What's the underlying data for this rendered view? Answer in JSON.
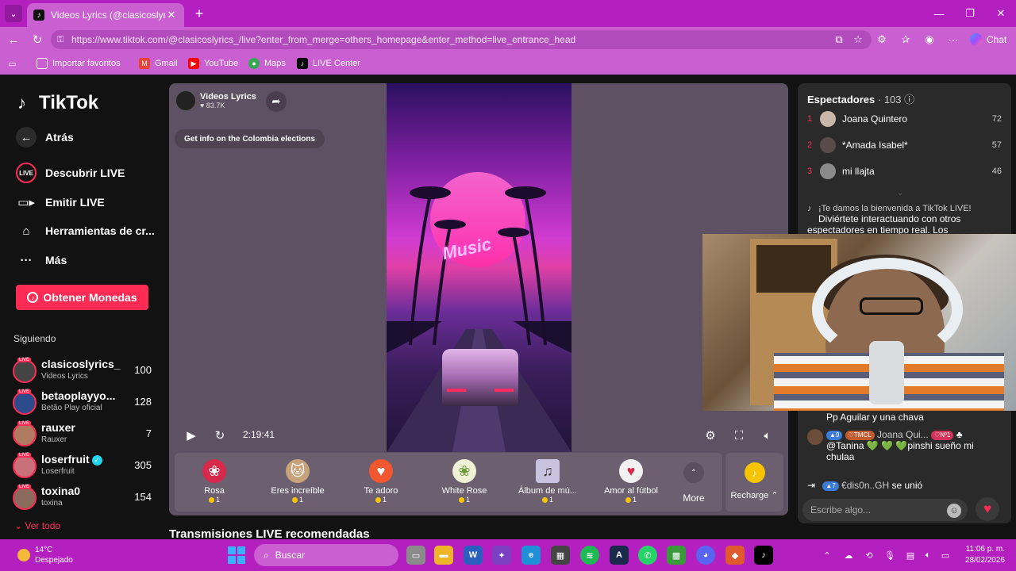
{
  "browser": {
    "tab_title": "Videos Lyrics (@clasicoslyrics_) est",
    "url": "https://www.tiktok.com/@clasicoslyrics_/live?enter_from_merge=others_homepage&enter_method=live_entrance_head",
    "chat_label": "Chat",
    "bookmarks": [
      "Importar favoritos",
      "Gmail",
      "YouTube",
      "Maps",
      "LIVE Center"
    ]
  },
  "sidebar": {
    "logo": "TikTok",
    "back": "Atrás",
    "nav": [
      "Descubrir LIVE",
      "Emitir LIVE",
      "Herramientas de cr...",
      "Más"
    ],
    "coins_button": "Obtener Monedas",
    "following_heading": "Siguiendo",
    "following": [
      {
        "name": "clasicoslyrics_",
        "sub": "Videos Lyrics",
        "count": "100"
      },
      {
        "name": "betaoplayyo...",
        "sub": "Betão Play oficial",
        "count": "128"
      },
      {
        "name": "rauxer",
        "sub": "Rauxer",
        "count": "7"
      },
      {
        "name": "loserfruit",
        "sub": "Loserfruit",
        "count": "305"
      },
      {
        "name": "toxina0",
        "sub": "toxina",
        "count": "154"
      }
    ],
    "see_all": "Ver todo"
  },
  "player": {
    "host_name": "Videos Lyrics",
    "host_likes": "83.7K",
    "info_pill": "Get info on the Colombia elections",
    "elapsed": "2:19:41",
    "gifts": [
      {
        "name": "Rosa",
        "cost": "1",
        "icon": "rose-icon"
      },
      {
        "name": "Eres increíble",
        "cost": "1",
        "icon": "cat-icon"
      },
      {
        "name": "Te adoro",
        "cost": "1",
        "icon": "heart-face-icon"
      },
      {
        "name": "White Rose",
        "cost": "1",
        "icon": "white-rose-icon"
      },
      {
        "name": "Álbum de mú...",
        "cost": "1",
        "icon": "album-icon"
      },
      {
        "name": "Amor al fútbol",
        "cost": "1",
        "icon": "football-heart-icon"
      }
    ],
    "more_label": "More",
    "recharge_label": "Recharge"
  },
  "recommended_heading": "Transmisiones LIVE recomendadas",
  "chat": {
    "viewers_label": "Espectadores",
    "viewers_count": "· 103",
    "top_viewers": [
      {
        "rank": "1",
        "name": "Joana Quintero",
        "score": "72"
      },
      {
        "rank": "2",
        "name": "*Amada Isabel*",
        "score": "57"
      },
      {
        "rank": "3",
        "name": "mi llajta",
        "score": "46"
      }
    ],
    "welcome_line1": "¡Te damos la bienvenida a TikTok LIVE!",
    "welcome_line2": "Diviértete interactuando con otros espectadores en tiempo real. Los",
    "prev_message": "Pp Aguilar y una chava",
    "message_user": "Joana Qui...",
    "message_text": "@Tanina 💚 💚 💚pinshi sueño mi chulaa",
    "badge_level": "9",
    "badge_team": "TMCL",
    "badge_rank": "Nº1",
    "join_level": "7",
    "join_user": "€dis0n..GH",
    "join_text": "se unió",
    "input_placeholder": "Escribe algo..."
  },
  "taskbar": {
    "temperature": "14°C",
    "weather": "Despejado",
    "search": "Buscar",
    "time": "11:06 p. m.",
    "date": "28/02/2026"
  },
  "colors": {
    "accent": "#fe2c55",
    "browser_frame": "#b41fc0",
    "player_bg": "#5e5163"
  }
}
